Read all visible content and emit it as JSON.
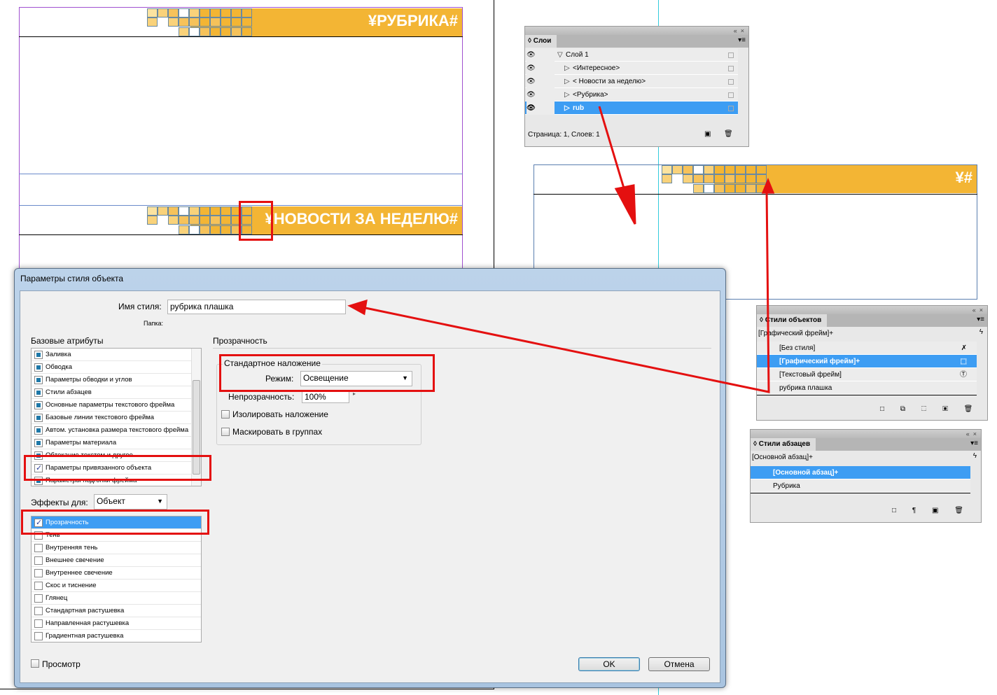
{
  "document": {
    "banner1_title": "¥РУБРИКА#",
    "banner2_title": "¥НОВОСТИ ЗА НЕДЕЛЮ#",
    "banner3_title": "¥#"
  },
  "layers_panel": {
    "tab": "Слои",
    "collapse_glyph": "«",
    "close_glyph": "×",
    "rows": [
      {
        "label": "Слой 1",
        "expanded": true,
        "selected": false
      },
      {
        "label": "<Интересное>",
        "selected": false
      },
      {
        "label": "< Новости за неделю>",
        "selected": false
      },
      {
        "label": "<Рубрика>",
        "selected": false
      },
      {
        "label": "rub",
        "selected": true
      }
    ],
    "footer": "Страница: 1, Слоев: 1"
  },
  "object_styles_panel": {
    "tab": "Стили объектов",
    "current": "[Графический фрейм]+",
    "rows": [
      {
        "label": "[Без стиля]",
        "icon": "no-style-icon"
      },
      {
        "label": "[Графический фрейм]+",
        "icon": "graphic-frame-icon",
        "selected": true
      },
      {
        "label": "[Текстовый фрейм]",
        "icon": "text-frame-icon"
      },
      {
        "label": "рубрика плашка"
      }
    ]
  },
  "paragraph_styles_panel": {
    "tab": "Стили абзацев",
    "current": "[Основной абзац]+",
    "rows": [
      {
        "label": "[Основной абзац]+",
        "selected": true
      },
      {
        "label": "Рубрика"
      }
    ]
  },
  "dialog": {
    "title": "Параметры стиля объекта",
    "style_name_label": "Имя стиля:",
    "style_name_value": "рубрика плашка",
    "folder_label": "Папка:",
    "basic_attrs_label": "Базовые атрибуты",
    "basic_attrs": [
      {
        "label": "Заливка",
        "state": "included"
      },
      {
        "label": "Обводка",
        "state": "included"
      },
      {
        "label": "Параметры обводки и углов",
        "state": "included"
      },
      {
        "label": "Стили абзацев",
        "state": "included"
      },
      {
        "label": "Основные параметры текстового фрейма",
        "state": "included"
      },
      {
        "label": "Базовые линии текстового фрейма",
        "state": "included"
      },
      {
        "label": "Автом. установка размера текстового фрейма",
        "state": "included"
      },
      {
        "label": "Параметры материала",
        "state": "included"
      },
      {
        "label": "Обтекание текстом и другое",
        "state": "included"
      },
      {
        "label": "Параметры привязанного объекта",
        "state": "checked"
      },
      {
        "label": "Параметры подгонки фрейма",
        "state": "included"
      }
    ],
    "effects_for_label": "Эффекты для:",
    "effects_for_value": "Объект",
    "effects": [
      {
        "label": "Прозрачность",
        "checked": true,
        "selected": true
      },
      {
        "label": "Тень",
        "checked": false
      },
      {
        "label": "Внутренняя тень",
        "checked": false
      },
      {
        "label": "Внешнее свечение",
        "checked": false
      },
      {
        "label": "Внутреннее свечение",
        "checked": false
      },
      {
        "label": "Скос и тиснение",
        "checked": false
      },
      {
        "label": "Глянец",
        "checked": false
      },
      {
        "label": "Стандартная растушевка",
        "checked": false
      },
      {
        "label": "Направленная растушевка",
        "checked": false
      },
      {
        "label": "Градиентная растушевка",
        "checked": false
      }
    ],
    "section_title": "Прозрачность",
    "group_title": "Стандартное наложение",
    "mode_label": "Режим:",
    "mode_value": "Освещение",
    "opacity_label": "Непрозрачность:",
    "opacity_value": "100%",
    "isolate_label": "Изолировать наложение",
    "isolate_checked": false,
    "knockout_label": "Маскировать в группах",
    "knockout_checked": false,
    "preview_label": "Просмотр",
    "preview_checked": false,
    "ok": "OK",
    "cancel": "Отмена"
  },
  "colors": {
    "banner": "#f3b534",
    "selection": "#3d9df3",
    "annotation": "#e41010"
  }
}
